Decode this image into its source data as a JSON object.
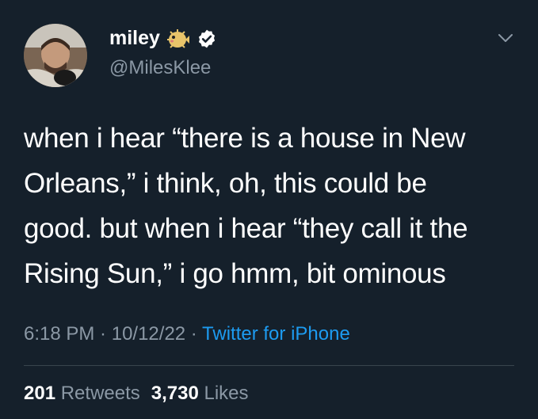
{
  "user": {
    "display_name": "miley",
    "handle": "@MilesKlee",
    "emoji_icon": "blowfish-emoji",
    "verified_icon": "verified-badge-icon",
    "avatar": "profile-photo"
  },
  "tweet": {
    "lines": [
      "when i hear “there is a house in New",
      "Orleans,” i think, oh, this could be",
      "good. but when i hear “they call it the",
      "Rising Sun,” i go hmm, bit ominous"
    ]
  },
  "meta": {
    "time": "6:18 PM",
    "separator1": " · ",
    "date": "10/12/22",
    "separator2": " · ",
    "source": "Twitter for iPhone"
  },
  "stats": {
    "retweets_count": "201",
    "retweets_label": "Retweets",
    "likes_count": "3,730",
    "likes_label": "Likes"
  },
  "colors": {
    "background": "#15202b",
    "text": "#ffffff",
    "secondary": "#8b98a5",
    "accent": "#1d9bf0",
    "divider": "#38444d"
  }
}
